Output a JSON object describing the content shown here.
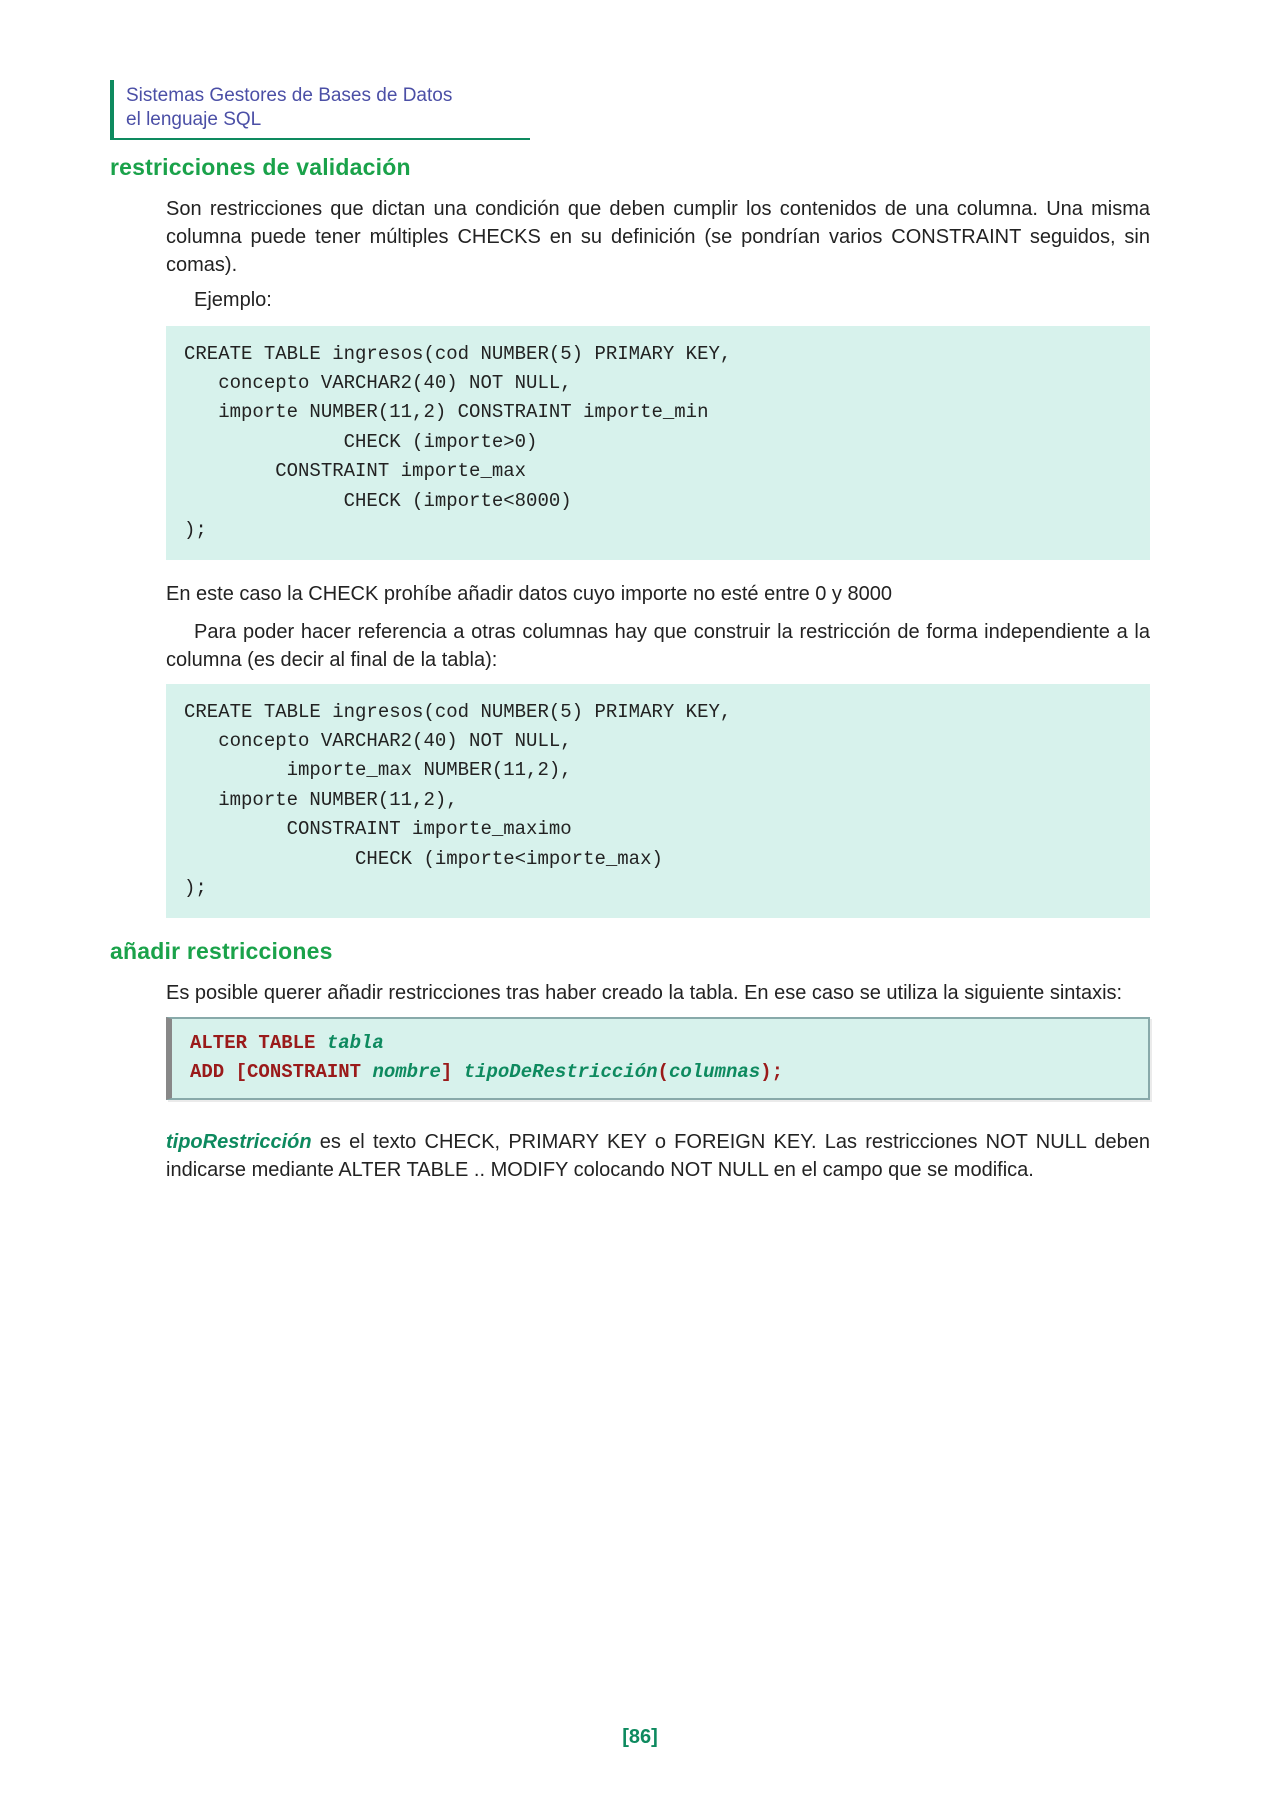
{
  "header": {
    "line1": "Sistemas Gestores de Bases de Datos",
    "line2": "el lenguaje SQL"
  },
  "section1": {
    "title": "restricciones de validación",
    "p1": "Son restricciones que dictan una condición que deben cumplir los contenidos de una columna. Una misma columna puede tener múltiples CHECKS en su definición (se pondrían varios CONSTRAINT seguidos, sin comas).",
    "example_label": "Ejemplo:",
    "code1": "CREATE TABLE ingresos(cod NUMBER(5) PRIMARY KEY,\n   concepto VARCHAR2(40) NOT NULL,\n   importe NUMBER(11,2) CONSTRAINT importe_min\n              CHECK (importe>0)\n        CONSTRAINT importe_max\n              CHECK (importe<8000)\n);",
    "p2": "En este caso la CHECK prohíbe añadir datos cuyo importe no esté entre 0 y 8000",
    "p3": "Para poder hacer referencia a otras columnas hay que construir la restricción de forma independiente a la columna (es decir al final de la tabla):",
    "code2": "CREATE TABLE ingresos(cod NUMBER(5) PRIMARY KEY,\n   concepto VARCHAR2(40) NOT NULL,\n         importe_max NUMBER(11,2),\n   importe NUMBER(11,2),\n         CONSTRAINT importe_maximo\n               CHECK (importe<importe_max)\n);"
  },
  "section2": {
    "title": "añadir restricciones",
    "p1": "Es posible querer añadir restricciones tras haber creado la tabla. En ese caso se utiliza la siguiente sintaxis:",
    "syntax": {
      "kw_alter": "ALTER TABLE",
      "tabla": "tabla",
      "kw_add": "ADD",
      "lb": "[",
      "kw_constraint": "CONSTRAINT",
      "nombre": "nombre",
      "rb": "]",
      "tipo": "tipoDeRestricción",
      "lp": "(",
      "columnas": "columnas",
      "rp": ")",
      "semi": ";"
    },
    "term": "tipoRestricción",
    "p2_rest": " es el texto CHECK, PRIMARY KEY o FOREIGN KEY. Las restricciones NOT NULL deben indicarse mediante ALTER TABLE .. MODIFY colocando NOT NULL en el campo que se modifica."
  },
  "page_number": "[86]"
}
